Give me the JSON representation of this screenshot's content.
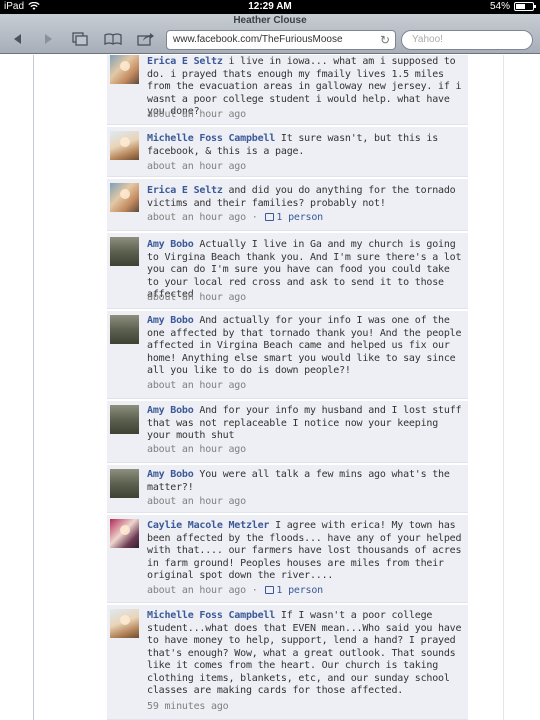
{
  "status_bar": {
    "device": "iPad",
    "time": "12:29 AM",
    "battery": "54%",
    "battery_fraction": 0.54
  },
  "browser": {
    "title": "Heather Clouse",
    "url": "www.facebook.com/TheFuriousMoose",
    "search_placeholder": "Yahoo!",
    "tab_count": "2"
  },
  "comments": [
    {
      "author": "Erica E Seltz",
      "avatar": "erica",
      "text": "i live in iowa... what am i supposed to do. i prayed thats enough my fmaily lives 1.5 miles from the evacuation areas in galloway new jersey. if i wasnt a poor college student i would help. what have you done?",
      "time": "about an hour ago",
      "likes": ""
    },
    {
      "author": "Michelle Foss Campbell",
      "avatar": "michelle",
      "text": "It sure wasn't, but this is facebook, & this is a page.",
      "time": "about an hour ago",
      "likes": ""
    },
    {
      "author": "Erica E Seltz",
      "avatar": "erica",
      "text": "and did you do anything for the tornado victims and their families? probably not!",
      "time": "about an hour ago",
      "likes": "1 person"
    },
    {
      "author": "Amy Bobo",
      "avatar": "amy",
      "text": "Actually I live in Ga and my church is going to Virgina Beach thank you. And I'm sure there's a lot you can do I'm sure you have can food you could take to your local red cross and ask to send it to those affected",
      "time": "about an hour ago",
      "likes": ""
    },
    {
      "author": "Amy Bobo",
      "avatar": "amy",
      "text": "And actually for your info I was one of the one affected by that tornado thank you! And the people affected in Virgina Beach came and helped us fix our home! Anything else smart you would like to say since all you like to do is down people?!",
      "time": "about an hour ago",
      "likes": ""
    },
    {
      "author": "Amy Bobo",
      "avatar": "amy",
      "text": "And for your info my husband and I lost stuff that was not replaceable I notice now your keeping your mouth shut",
      "time": "about an hour ago",
      "likes": ""
    },
    {
      "author": "Amy Bobo",
      "avatar": "amy",
      "text": "You were all talk a few mins ago what's the matter?!",
      "time": "about an hour ago",
      "likes": ""
    },
    {
      "author": "Caylie Macole Metzler",
      "avatar": "caylie",
      "text": "I agree with erica! My town has been affected by the floods... have any of your helped with that.... our farmers have lost thousands of acres in farm ground! Peoples houses are miles from their original spot down the river....",
      "time": "about an hour ago",
      "likes": "1 person"
    },
    {
      "author": "Michelle Foss Campbell",
      "avatar": "michelle",
      "text": "If I wasn't a poor college student...what does that EVEN mean...Who said you have to have money to help, support, lend a hand? I prayed that's enough? Wow, what a great outlook. That sounds like it comes from the heart. Our church is taking clothing items, blankets, etc, and our sunday school classes are making cards for those affected.",
      "time": "59 minutes ago",
      "likes": ""
    }
  ]
}
